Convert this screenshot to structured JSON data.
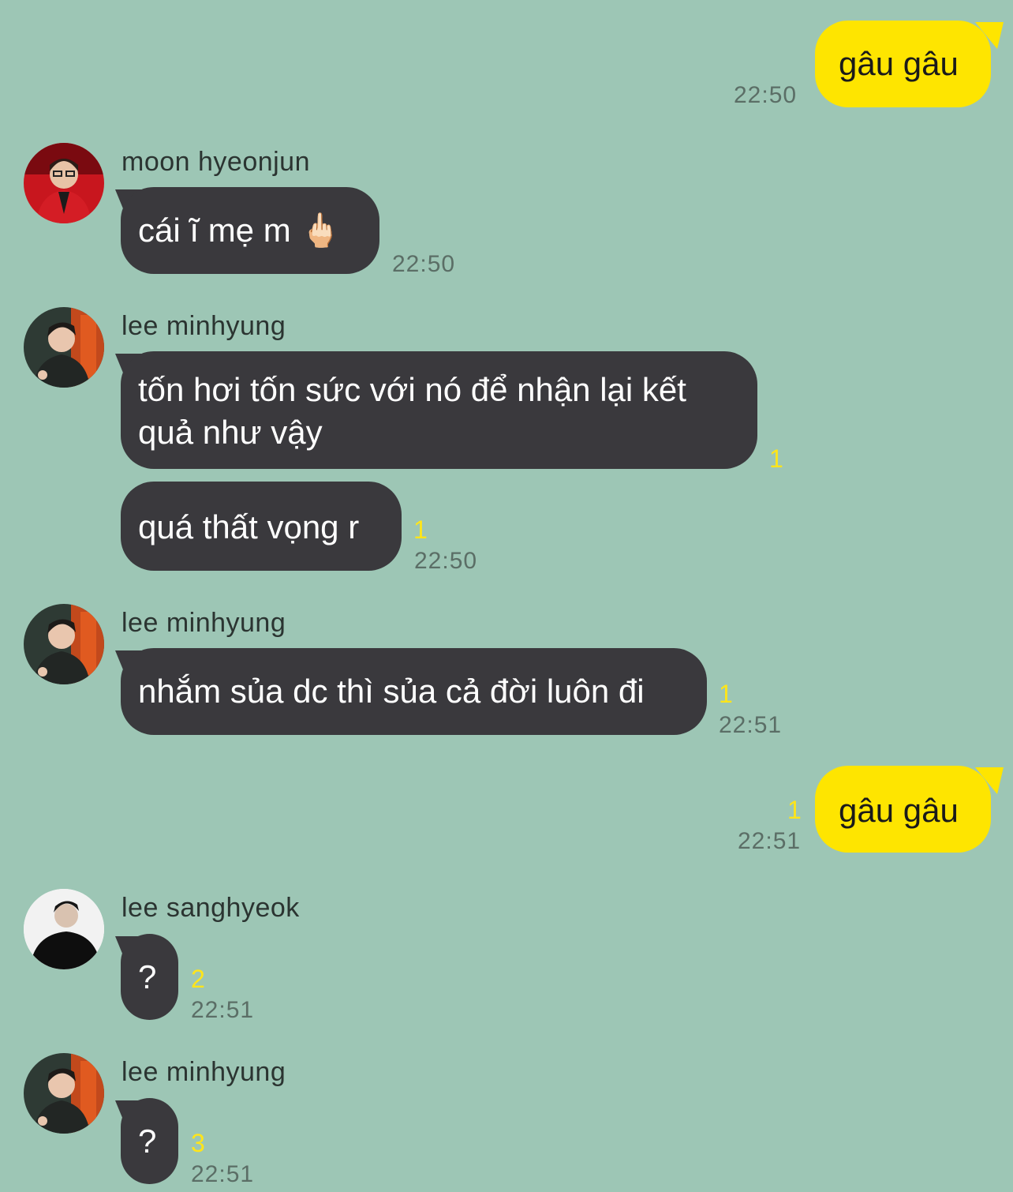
{
  "messages": [
    {
      "sender": "me",
      "text": "gâu gâu",
      "time": "22:50"
    },
    {
      "sender": "moon hyeonjun",
      "text": "cái ĩ mẹ m 🖕🏻",
      "time": "22:50"
    },
    {
      "sender": "lee minhyung",
      "text": "tốn hơi tốn sức với nó để nhận lại kết\nquả như vậy",
      "unread": "1"
    },
    {
      "sender": "lee minhyung",
      "text": "quá thất vọng r",
      "unread": "1",
      "time": "22:50"
    },
    {
      "sender": "lee minhyung",
      "text": "nhắm sủa dc thì sủa cả đời luôn đi",
      "unread": "1",
      "time": "22:51"
    },
    {
      "sender": "me",
      "text": "gâu gâu",
      "unread": "1",
      "time": "22:51"
    },
    {
      "sender": "lee sanghyeok",
      "text": "?",
      "unread": "2",
      "time": "22:51"
    },
    {
      "sender": "lee minhyung",
      "text": "?",
      "unread": "3",
      "time": "22:51"
    }
  ],
  "colors": {
    "background": "#9dc6b5",
    "bubble_dark": "#3a393d",
    "bubble_self": "#fee500",
    "unread": "#ffe51a"
  }
}
